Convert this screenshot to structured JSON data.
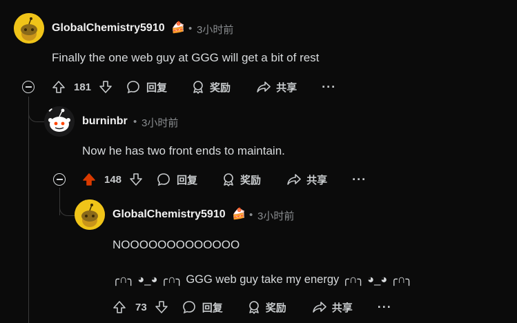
{
  "comments": [
    {
      "username": "GlobalChemistry5910",
      "flair_icon": "cake-icon",
      "separator": "•",
      "time": "3小时前",
      "body": "Finally the one web guy at GGG will get a bit of rest",
      "score": "181",
      "upvoted": false,
      "reply_label": "回复",
      "award_label": "奖励",
      "share_label": "共享",
      "more_label": "···"
    },
    {
      "username": "burninbr",
      "time": "3小时前",
      "separator": "•",
      "body": "Now he has two front ends to maintain.",
      "score": "148",
      "upvoted": true,
      "reply_label": "回复",
      "award_label": "奖励",
      "share_label": "共享",
      "more_label": "···"
    },
    {
      "username": "GlobalChemistry5910",
      "flair_icon": "cake-icon",
      "separator": "•",
      "time": "3小时前",
      "body_line1": "NOOOOOOOOOOOOO",
      "body_line2": "╭∩╮ ◕_◕ ╭∩╮ GGG web guy take my energy ╭∩╮ ◕_◕ ╭∩╮",
      "score": "73",
      "upvoted": false,
      "reply_label": "回复",
      "award_label": "奖励",
      "share_label": "共享",
      "more_label": "···"
    }
  ],
  "colors": {
    "background": "#0b0b0b",
    "upvote_active": "#d93a00",
    "avatar_yellow": "#f0c419"
  }
}
